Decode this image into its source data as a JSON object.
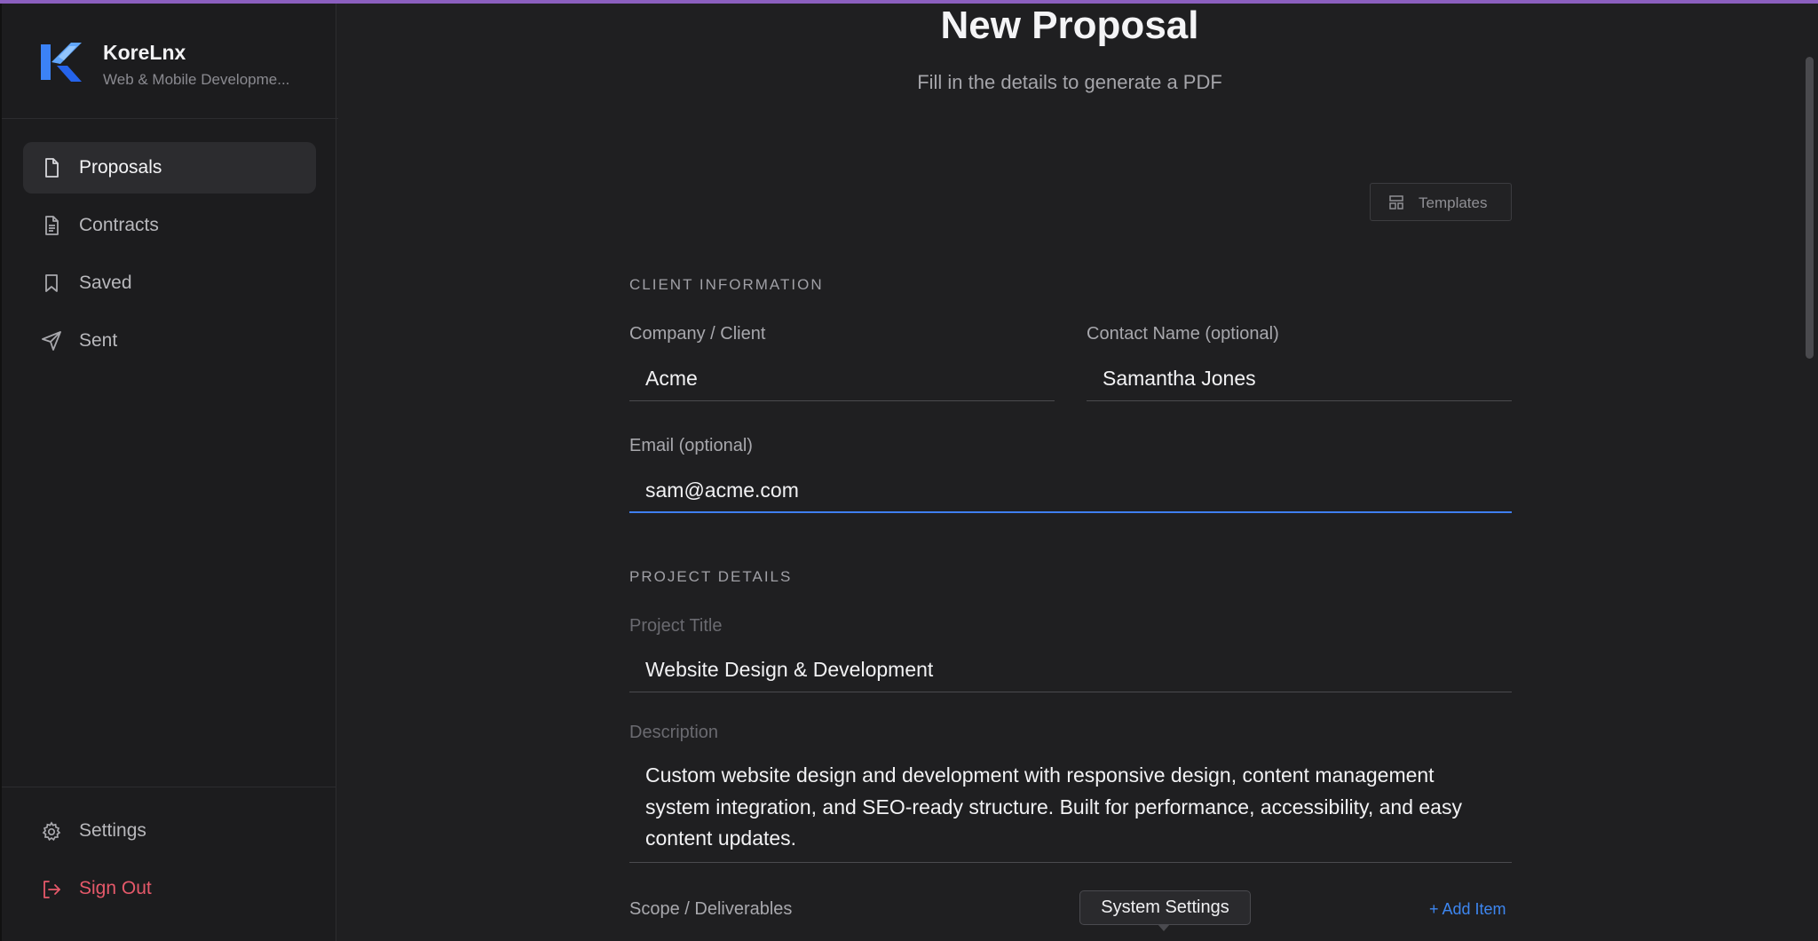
{
  "brand": {
    "name": "KoreLnx",
    "subtitle": "Web & Mobile Developme..."
  },
  "sidebar": {
    "items": [
      {
        "label": "Proposals",
        "icon": "file-icon"
      },
      {
        "label": "Contracts",
        "icon": "file-text-icon"
      },
      {
        "label": "Saved",
        "icon": "bookmark-icon"
      },
      {
        "label": "Sent",
        "icon": "send-icon"
      }
    ],
    "settings_label": "Settings",
    "signout_label": "Sign Out"
  },
  "page": {
    "title": "New Proposal",
    "subtitle": "Fill in the details to generate a PDF",
    "templates_label": "Templates"
  },
  "client_section": {
    "heading": "CLIENT INFORMATION",
    "company_label": "Company / Client",
    "company_value": "Acme",
    "contact_label": "Contact Name (optional)",
    "contact_value": "Samantha Jones",
    "email_label": "Email (optional)",
    "email_value": "sam@acme.com"
  },
  "project_section": {
    "heading": "PROJECT DETAILS",
    "title_label": "Project Title",
    "title_value": "Website Design & Development",
    "description_label": "Description",
    "description_value": "Custom website design and development with responsive design, content management system integration, and SEO-ready structure. Built for performance, accessibility, and easy content updates.",
    "scope_label": "Scope / Deliverables",
    "add_item_label": "+ Add Item"
  },
  "tooltip": {
    "text": "System Settings"
  },
  "colors": {
    "accent": "#3f7ff0",
    "danger": "#e6596a",
    "topline": "#8b5fbf"
  }
}
